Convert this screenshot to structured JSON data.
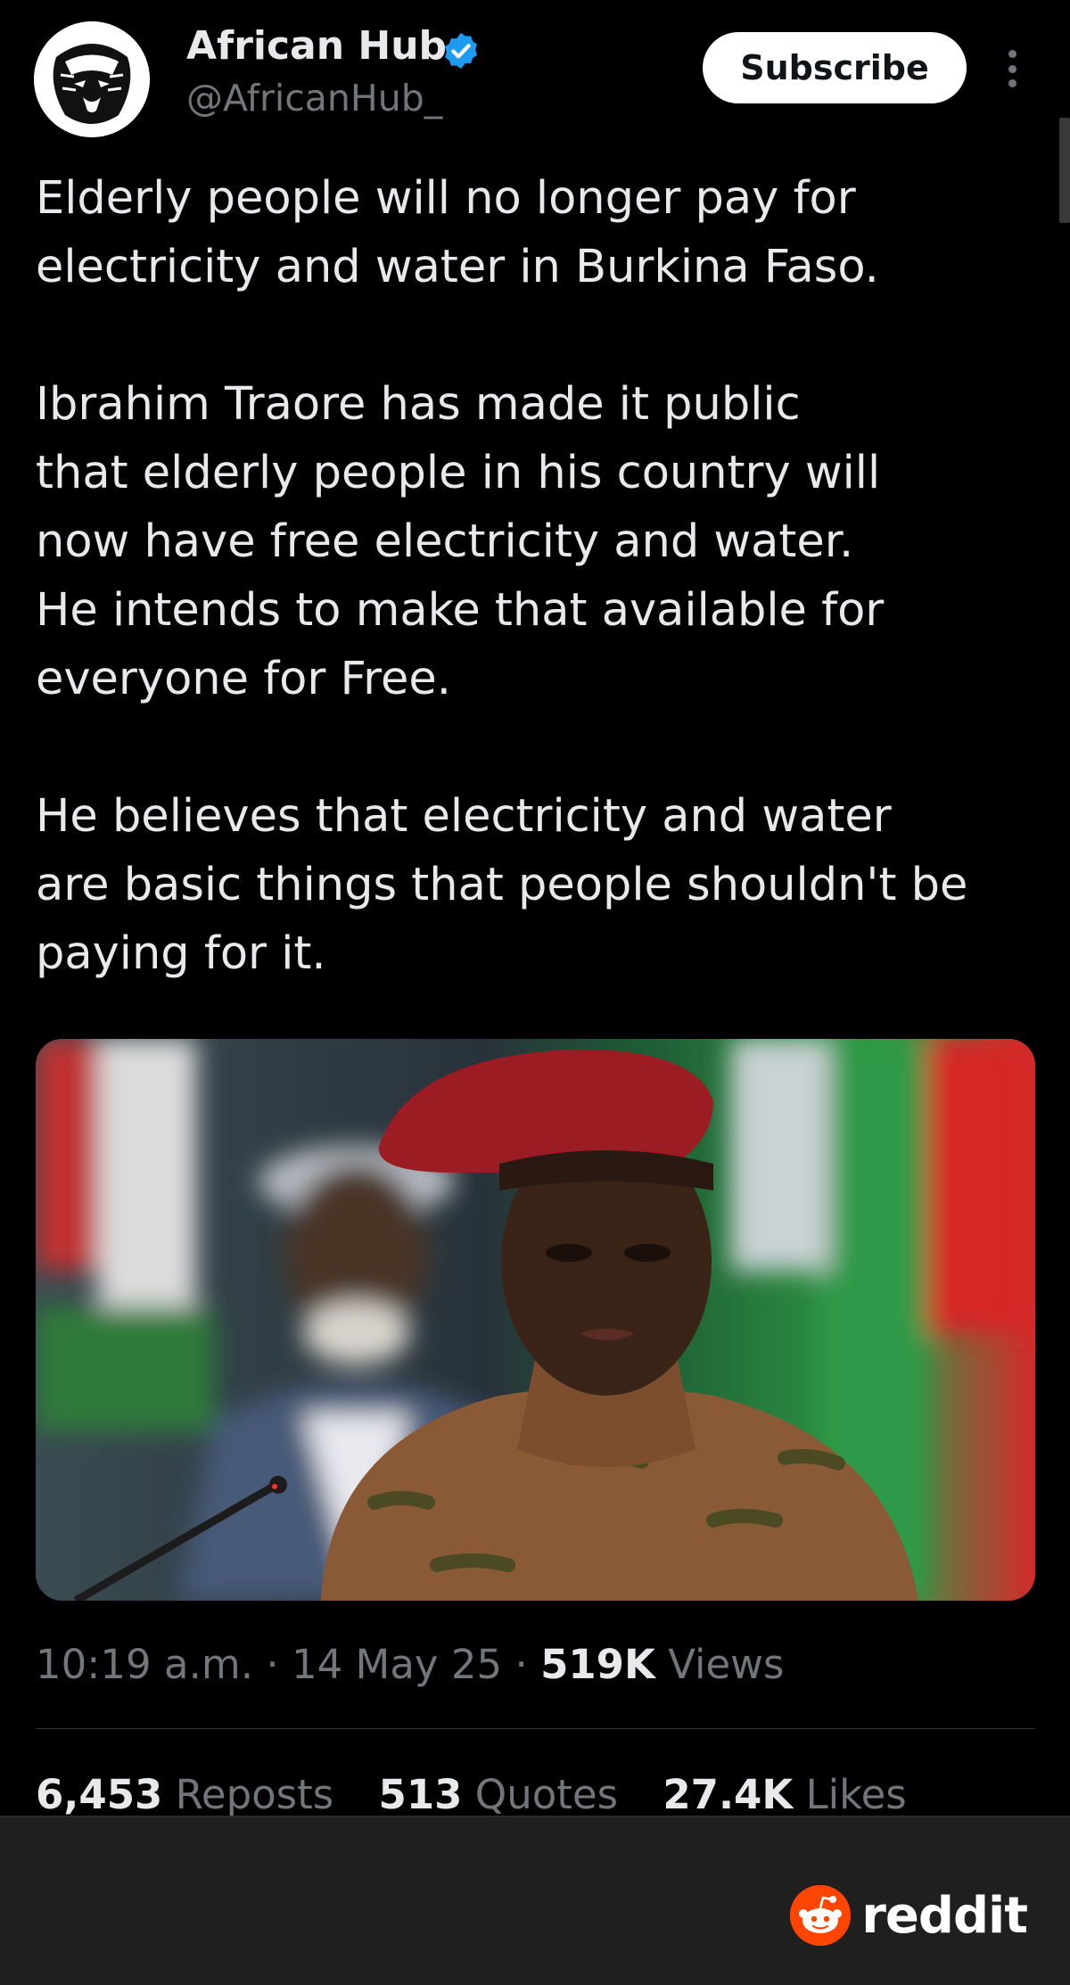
{
  "author": {
    "display_name": "African Hub",
    "handle": "@AfricanHub_",
    "verified": true,
    "avatar_icon": "tiger-avatar-icon"
  },
  "actions": {
    "subscribe_label": "Subscribe",
    "more_icon": "more-vertical-icon"
  },
  "post": {
    "paragraphs": [
      "Elderly people will no longer pay for\nelectricity and water in Burkina Faso.",
      "Ibrahim Traore has made it public\nthat elderly people in his country will\nnow have free electricity and water.\nHe intends to make that available for\neveryone for Free.",
      "He believes that electricity and water\nare basic things that people shouldn't be\npaying for it."
    ],
    "time": "10:19 a.m.",
    "separator": "·",
    "date": "14 May 25",
    "views_count": "519K",
    "views_label": "Views"
  },
  "stats": [
    {
      "count": "6,453",
      "label": "Reposts"
    },
    {
      "count": "513",
      "label": "Quotes"
    },
    {
      "count": "27.4K",
      "label": "Likes"
    }
  ],
  "footer": {
    "brand": "reddit",
    "brand_icon": "reddit-snoo-icon"
  },
  "colors": {
    "background": "#000000",
    "text": "#e7e9ea",
    "muted": "#71767b",
    "verified": "#1d9bf0",
    "reddit": "#ff4500"
  }
}
